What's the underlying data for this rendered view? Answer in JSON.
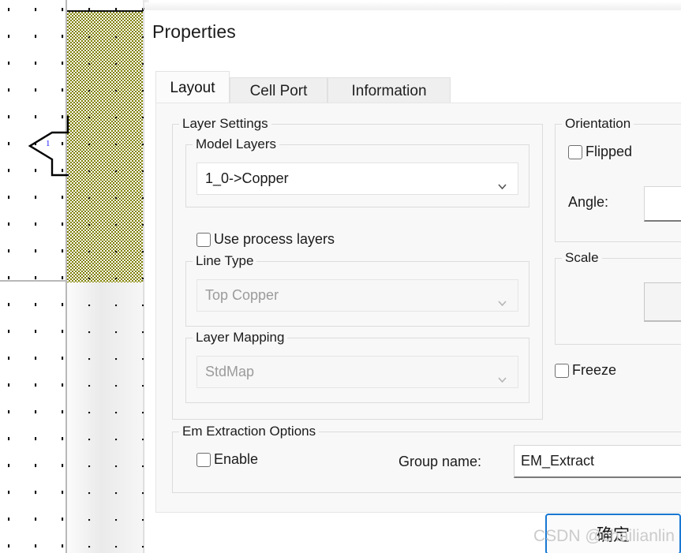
{
  "window": {
    "title": "Properties"
  },
  "canvas": {
    "port_label": "1",
    "copper_color": "#7f7f00",
    "grid_dot_color": "#111111",
    "port_marker_name": "port-arrow-marker"
  },
  "tabs": [
    {
      "label": "Layout",
      "active": true
    },
    {
      "label": "Cell Port",
      "active": false
    },
    {
      "label": "Information",
      "active": false
    }
  ],
  "layout_tab": {
    "layer_settings": {
      "legend": "Layer Settings",
      "model_layers": {
        "legend": "Model Layers",
        "value": "1_0->Copper",
        "enabled": true
      },
      "use_process_layers": {
        "label": "Use process layers",
        "checked": false
      },
      "line_type": {
        "legend": "Line Type",
        "value": "Top Copper",
        "enabled": false
      },
      "layer_mapping": {
        "legend": "Layer Mapping",
        "value": "StdMap",
        "enabled": false
      }
    },
    "orientation": {
      "legend": "Orientation",
      "flipped": {
        "label": "Flipped",
        "checked": false
      },
      "angle": {
        "label": "Angle:",
        "value": "",
        "enabled": true
      }
    },
    "scale": {
      "legend": "Scale",
      "value": "",
      "enabled": false
    },
    "freeze": {
      "label": "Freeze",
      "checked": false
    },
    "em_extraction": {
      "legend": "Em Extraction Options",
      "enable": {
        "label": "Enable",
        "checked": false
      },
      "group_name": {
        "label": "Group name:",
        "value": "EM_Extract"
      }
    }
  },
  "footer": {
    "ok_label": "确定"
  },
  "watermark": {
    "text": "CSDN @chailianlin",
    "color": "#cbcbcb"
  }
}
